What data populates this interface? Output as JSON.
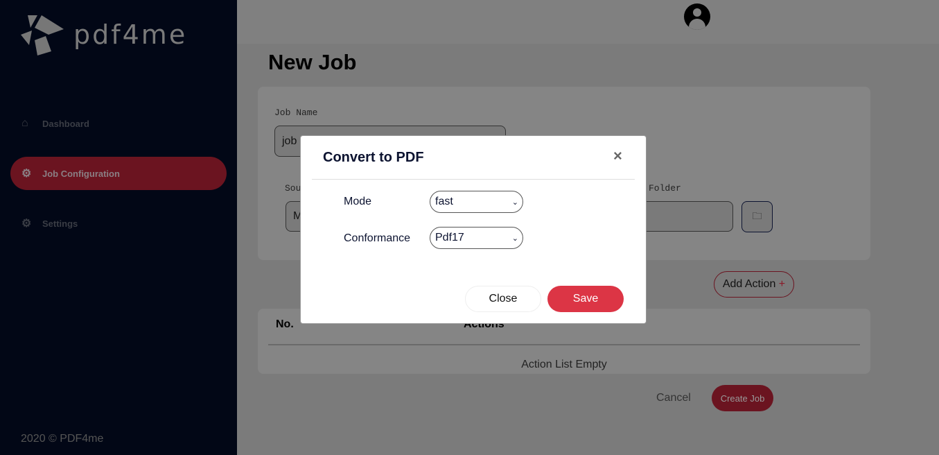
{
  "sidebar": {
    "brand": "pdf4me",
    "items": [
      {
        "label": "Dashboard",
        "icon": "home-icon"
      },
      {
        "label": "Job Configuration",
        "icon": "cogs-icon",
        "active": true
      },
      {
        "label": "Settings",
        "icon": "gear-icon"
      }
    ],
    "footer": "2020 © PDF4me"
  },
  "page": {
    "title": "New Job",
    "job_name_label": "Job Name",
    "job_name_value": "job",
    "source_label": "Sou",
    "source_value": "M",
    "folder_label": "Folder",
    "add_action": "Add Action",
    "add_icon": "+",
    "table": {
      "headers": [
        "No.",
        "Actions"
      ],
      "empty": "Action List Empty"
    },
    "cancel": "Cancel",
    "create": "Create Job"
  },
  "modal": {
    "title": "Convert to PDF",
    "fields": [
      {
        "label": "Mode",
        "value": "fast"
      },
      {
        "label": "Conformance",
        "value": "Pdf17"
      }
    ],
    "close": "Close",
    "save": "Save"
  },
  "colors": {
    "accent": "#dc3545",
    "sidebar": "#020716"
  }
}
